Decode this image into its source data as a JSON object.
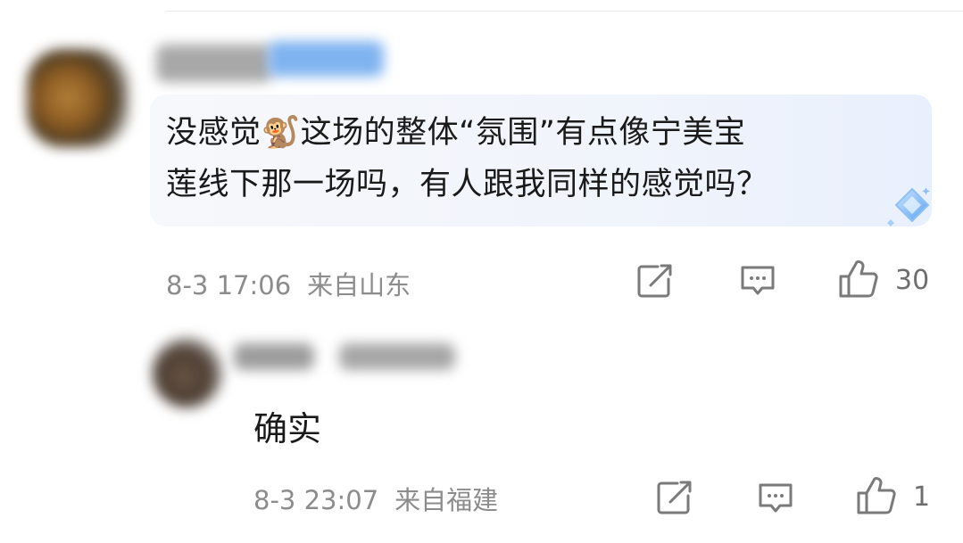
{
  "comment": {
    "line1_before": "没感觉",
    "emoji": "🐒",
    "line1_after": "这场的整体“氛围”有点像宁美宝",
    "line2": "莲线下那一场吗，有人跟我同样的感觉吗？",
    "time": "8-3 17:06",
    "location": "来自山东",
    "likes": "30"
  },
  "reply": {
    "text": "确实",
    "time": "8-3 23:07",
    "location": "来自福建",
    "likes": "1"
  },
  "colors": {
    "meta_text": "#8c8c8c",
    "icon": "#7a7a7a",
    "bubble": "#eff3fb",
    "badge": "#7bb6f5"
  }
}
